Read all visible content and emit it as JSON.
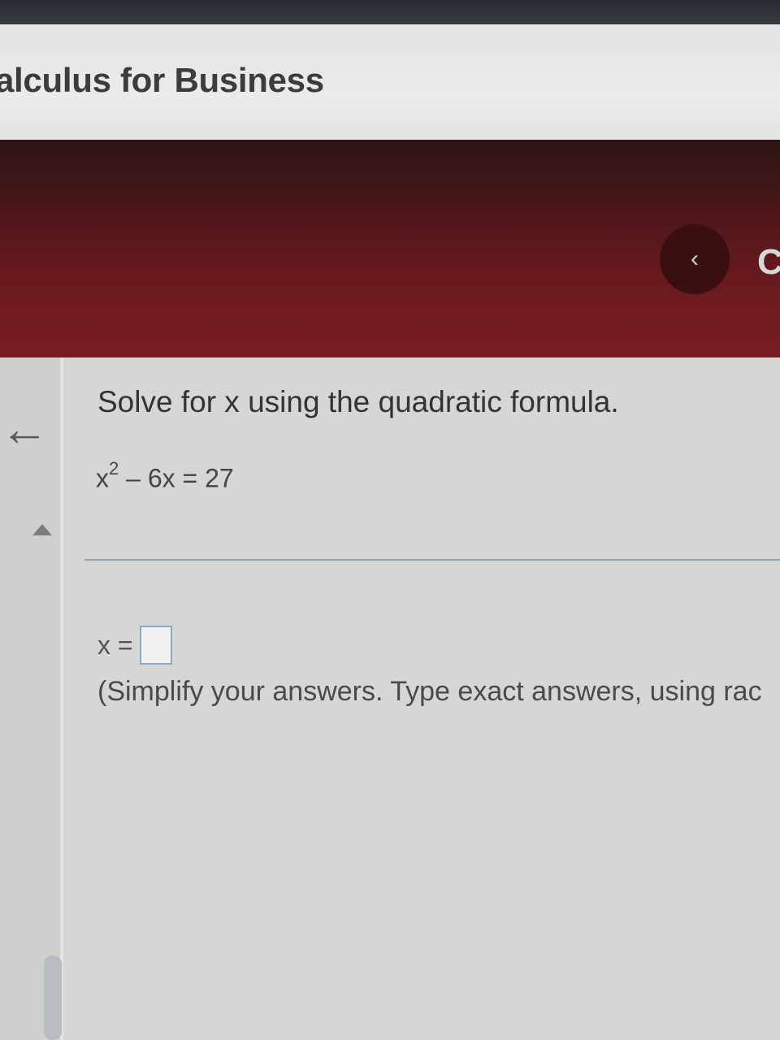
{
  "header": {
    "course_title": "alculus for Business"
  },
  "nav": {
    "prev_glyph": "‹",
    "next_partial_glyph": "C"
  },
  "sidebar": {
    "back_glyph": "←"
  },
  "question": {
    "prompt": "Solve for x using the quadratic formula.",
    "equation_base": "x",
    "equation_exponent": "2",
    "equation_rest": " – 6x = 27"
  },
  "answer": {
    "label": "x =",
    "value": "",
    "instructions": "(Simplify your answers. Type exact answers, using rac"
  },
  "icons": {
    "back": "back-arrow-icon",
    "prev": "chevron-left-icon",
    "collapse": "triangle-up-icon"
  }
}
